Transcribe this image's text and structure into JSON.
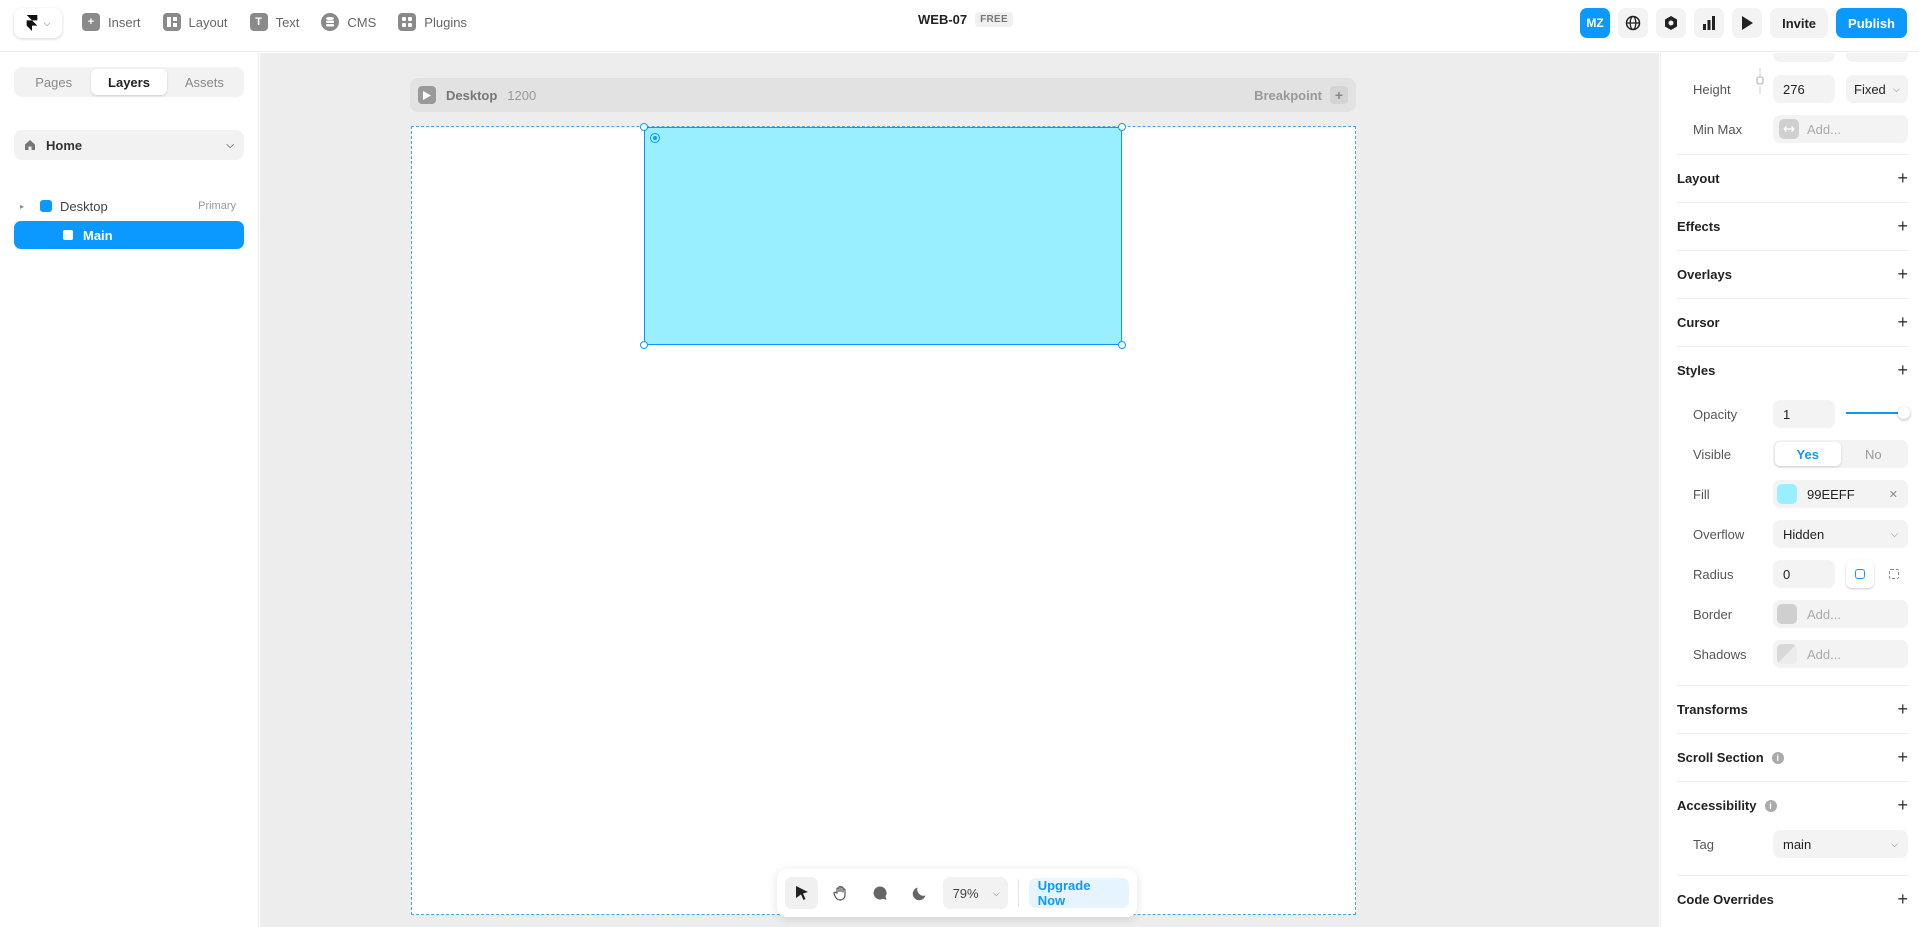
{
  "topbar": {
    "nav": [
      {
        "label": "Insert",
        "icon": "plus-icon"
      },
      {
        "label": "Layout",
        "icon": "layout-icon"
      },
      {
        "label": "Text",
        "icon": "text-icon"
      },
      {
        "label": "CMS",
        "icon": "database-icon"
      },
      {
        "label": "Plugins",
        "icon": "plugins-icon"
      }
    ],
    "project_name": "WEB-07",
    "plan_badge": "FREE",
    "avatar_initials": "MZ",
    "invite_label": "Invite",
    "publish_label": "Publish"
  },
  "left_panel": {
    "tabs": [
      {
        "label": "Pages",
        "active": false
      },
      {
        "label": "Layers",
        "active": true
      },
      {
        "label": "Assets",
        "active": false
      }
    ],
    "page_select": "Home",
    "layers": [
      {
        "name": "Desktop",
        "tag": "Primary"
      },
      {
        "name": "Main",
        "selected": true
      }
    ]
  },
  "canvas": {
    "breakpoint_name": "Desktop",
    "breakpoint_width": "1200",
    "breakpoint_label": "Breakpoint",
    "zoom": "79%",
    "upgrade_label": "Upgrade Now",
    "fill_color": "#99EEFF"
  },
  "right_panel": {
    "size": {
      "height_label": "Height",
      "height_value": "276",
      "height_mode": "Fixed",
      "minmax_label": "Min Max",
      "minmax_placeholder": "Add..."
    },
    "sections": {
      "layout": "Layout",
      "effects": "Effects",
      "overlays": "Overlays",
      "cursor": "Cursor",
      "styles": "Styles",
      "transforms": "Transforms",
      "scroll_section": "Scroll Section",
      "accessibility": "Accessibility",
      "code_overrides": "Code Overrides"
    },
    "styles": {
      "opacity_label": "Opacity",
      "opacity_value": "1",
      "visible_label": "Visible",
      "visible_yes": "Yes",
      "visible_no": "No",
      "fill_label": "Fill",
      "fill_value": "99EEFF",
      "overflow_label": "Overflow",
      "overflow_value": "Hidden",
      "radius_label": "Radius",
      "radius_value": "0",
      "border_label": "Border",
      "border_placeholder": "Add...",
      "shadows_label": "Shadows",
      "shadows_placeholder": "Add..."
    },
    "accessibility": {
      "tag_label": "Tag",
      "tag_value": "main"
    }
  },
  "colors": {
    "accent": "#0B99FF",
    "fill": "#99EEFF"
  }
}
